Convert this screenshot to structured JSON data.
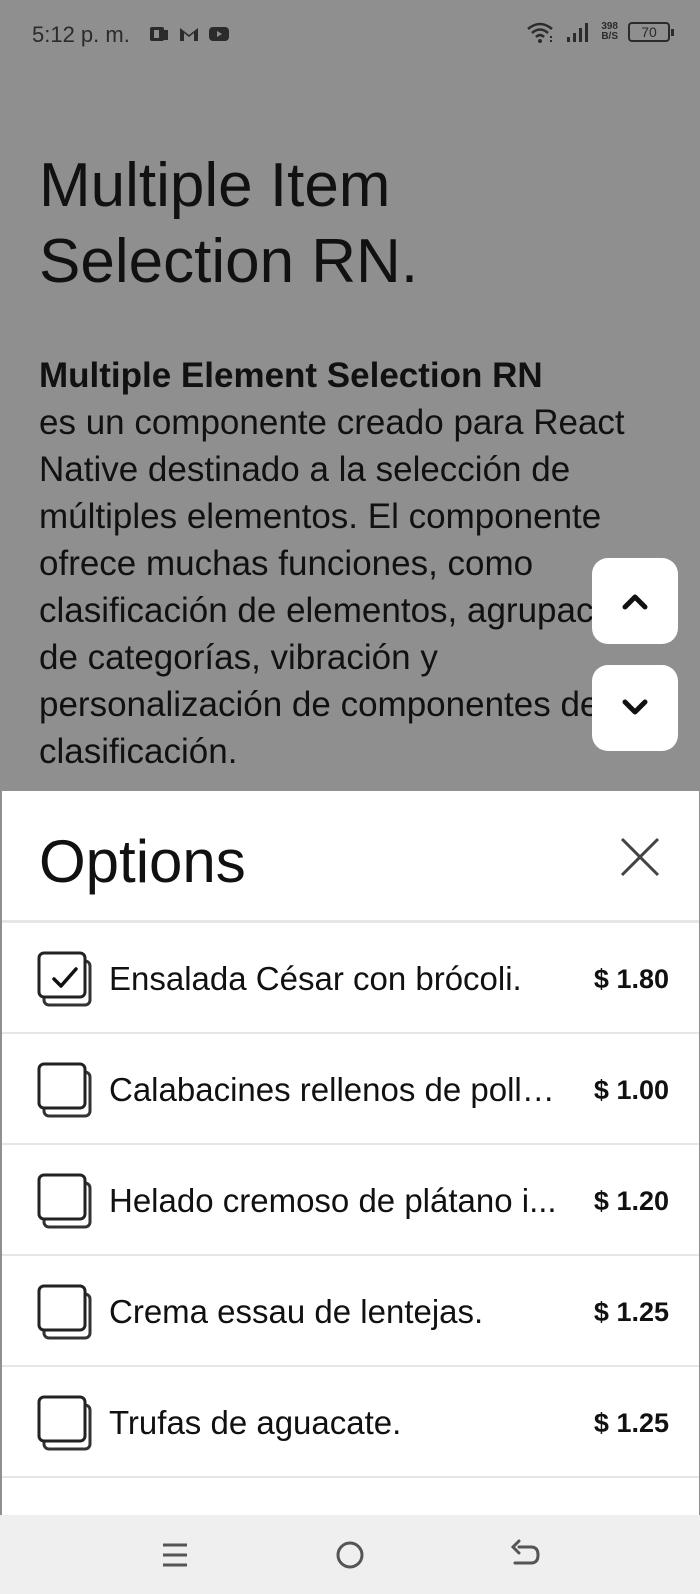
{
  "status_bar": {
    "time": "5:12 p. m.",
    "left_icons": [
      "reader-icon",
      "gmail-icon",
      "youtube-icon"
    ],
    "right_icons": [
      "wifi-icon",
      "signal-icon"
    ],
    "net_speed_value": "398",
    "net_speed_unit": "B/S",
    "battery_level": "70"
  },
  "page": {
    "title": "Multiple Item Selection RN.",
    "intro_bold": "Multiple Element Selection RN",
    "intro_text": "es un componente creado para React Native destinado a la selección de múltiples elementos. El componente ofrece muchas funciones, como clasificación de elementos, agrupación de categorías, vibración y personalización de componentes de clasificación."
  },
  "scroll_buttons": {
    "up_icon": "chevron-up-icon",
    "down_icon": "chevron-down-icon"
  },
  "sheet": {
    "title": "Options",
    "close_icon": "close-icon",
    "options": [
      {
        "label": "Ensalada César con brócoli.",
        "price": "$ 1.80",
        "checked": true
      },
      {
        "label": "Calabacines rellenos de pollo con queso.",
        "price": "$ 1.00",
        "checked": false
      },
      {
        "label": "Helado cremoso de plátano i...",
        "price": "$ 1.20",
        "checked": false
      },
      {
        "label": "Crema essau de lentejas.",
        "price": "$ 1.25",
        "checked": false
      },
      {
        "label": "Trufas de aguacate.",
        "price": "$ 1.25",
        "checked": false
      }
    ]
  },
  "nav_bar": {
    "icons": [
      "menu-icon",
      "home-icon",
      "back-icon"
    ]
  }
}
